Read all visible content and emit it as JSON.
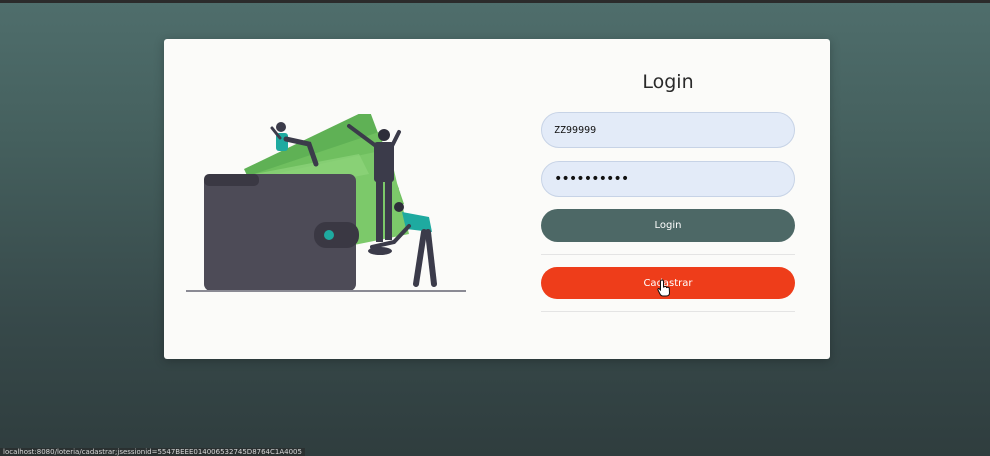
{
  "login_form": {
    "title": "Login",
    "username_value": "ZZ99999",
    "password_value": "••••••••••",
    "login_button_label": "Login",
    "register_button_label": "Cadastrar"
  },
  "status_bar": {
    "url": "localhost:8080/loteria/cadastrar;jsessionid=5547BEEE014006532745D8764C1A4005"
  },
  "illustration": {
    "icon": "wallet-money-people-illustration"
  },
  "colors": {
    "background_top": "#4f6e6c",
    "background_bottom": "#2f3d3e",
    "card": "#fbfbf9",
    "input_bg": "#e3ebf8",
    "login_button": "#4d6866",
    "register_button": "#ee3d1a",
    "money_green": "#6fbf5f",
    "wallet": "#4d4b57",
    "accent_teal": "#1eaaa0"
  }
}
